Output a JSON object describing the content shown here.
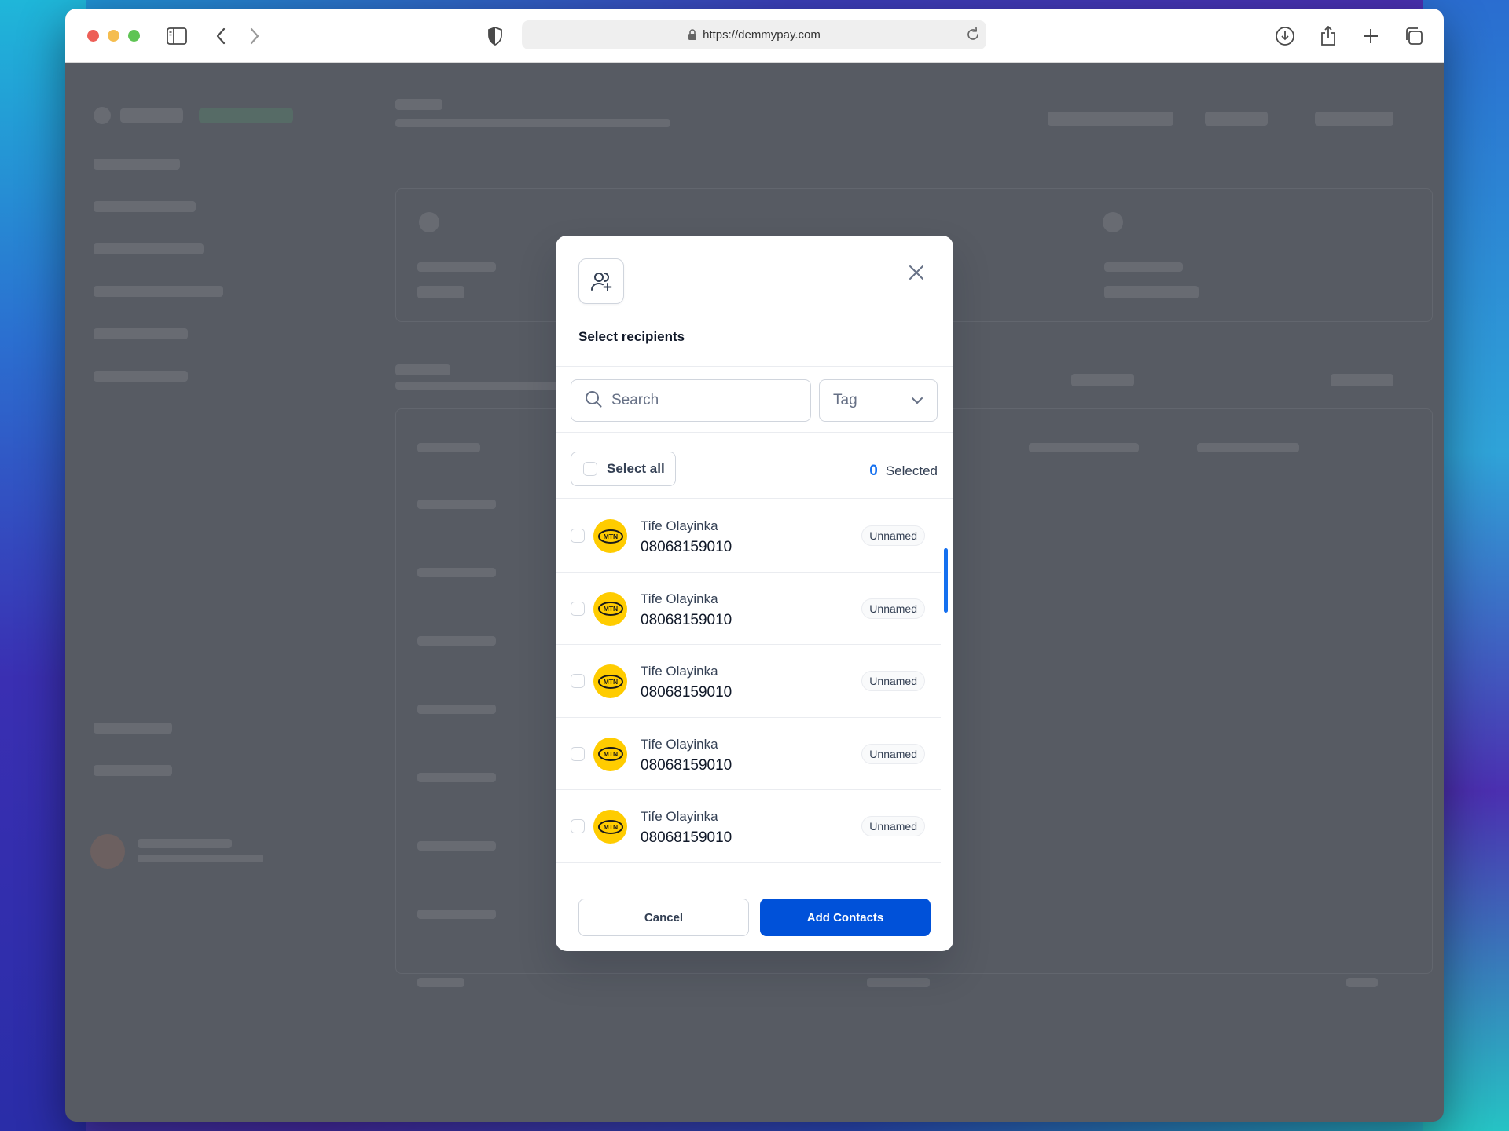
{
  "browser": {
    "url": "https://demmypay.com"
  },
  "modal": {
    "title": "Select recipients",
    "search_placeholder": "Search",
    "tag_label": "Tag",
    "select_all_label": "Select all",
    "selected_count": "0",
    "selected_label": "Selected",
    "cancel_label": "Cancel",
    "add_label": "Add Contacts",
    "accent_color": "#0051d9",
    "recipients": [
      {
        "name": "Tife Olayinka",
        "phone": "08068159010",
        "tag": "Unnamed",
        "network": "MTN"
      },
      {
        "name": "Tife Olayinka",
        "phone": "08068159010",
        "tag": "Unnamed",
        "network": "MTN"
      },
      {
        "name": "Tife Olayinka",
        "phone": "08068159010",
        "tag": "Unnamed",
        "network": "MTN"
      },
      {
        "name": "Tife Olayinka",
        "phone": "08068159010",
        "tag": "Unnamed",
        "network": "MTN"
      },
      {
        "name": "Tife Olayinka",
        "phone": "08068159010",
        "tag": "Unnamed",
        "network": "MTN"
      }
    ]
  },
  "icons": {
    "close": "close-icon",
    "add_user": "user-plus-icon",
    "search": "search-icon",
    "chevron": "chevron-down-icon"
  }
}
